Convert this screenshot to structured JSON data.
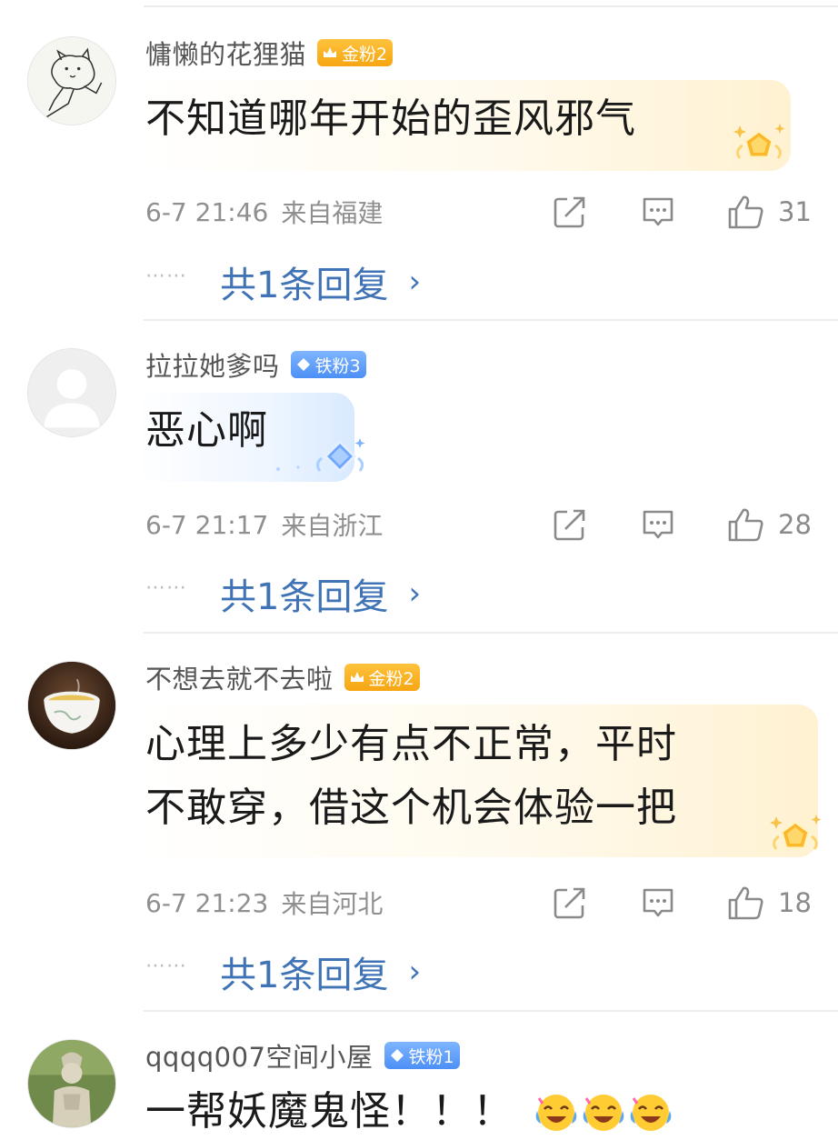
{
  "comments": [
    {
      "username": "慵懒的花狸猫",
      "badge": "金粉2",
      "badge_type": "gold",
      "text_lines": [
        "不知道哪年开始的歪风邪气"
      ],
      "time": "6-7 21:46",
      "location": "来自福建",
      "likes": "31",
      "reply_text": "共1条回复",
      "reply_dots": "⋯⋯",
      "reply_chevron": "›",
      "avatar": "cat-sketch-avatar"
    },
    {
      "username": "拉拉她爹吗",
      "badge": "铁粉3",
      "badge_type": "iron",
      "text_lines": [
        "恶心啊"
      ],
      "time": "6-7 21:17",
      "location": "来自浙江",
      "likes": "28",
      "reply_text": "共1条回复",
      "reply_dots": "⋯⋯",
      "reply_chevron": "›",
      "avatar": "default-user-avatar"
    },
    {
      "username": "不想去就不去啦",
      "badge": "金粉2",
      "badge_type": "gold",
      "text_lines": [
        "心理上多少有点不正常，平时",
        "不敢穿，借这个机会体验一把"
      ],
      "time": "6-7 21:23",
      "location": "来自河北",
      "likes": "18",
      "reply_text": "共1条回复",
      "reply_dots": "⋯⋯",
      "reply_chevron": "›",
      "avatar": "tea-cup-avatar"
    },
    {
      "username": "qqqq007空间小屋",
      "badge": "铁粉1",
      "badge_type": "iron",
      "text_lines": [
        "一帮妖魔鬼怪！！！"
      ],
      "emoji": [
        "laughing-crying-emoji",
        "laughing-crying-emoji",
        "laughing-crying-emoji"
      ],
      "avatar": "statue-avatar"
    }
  ],
  "colors": {
    "reply_link": "#3f73b6",
    "gold_badge": "#f6a612",
    "iron_badge": "#4c8ff5",
    "meta_text": "#8f8f8f"
  }
}
